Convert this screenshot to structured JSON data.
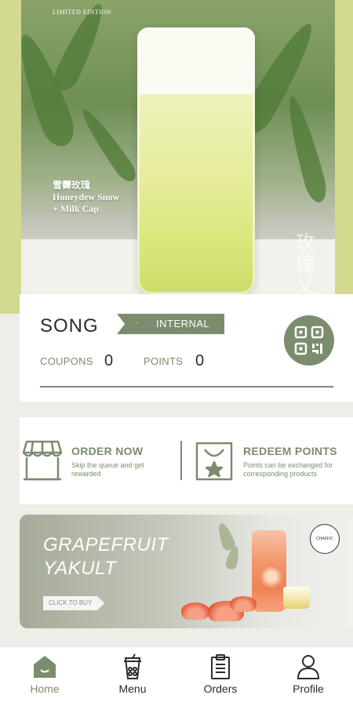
{
  "hero": {
    "tag": "LIMITED EDITION",
    "name_cn": "雪霽玫瑰",
    "name_line1": "Honeydew Snow",
    "name_line2": "+ Milk Cap",
    "watermark": "玫瑰乂"
  },
  "member": {
    "name": "SONG",
    "tier": "INTERNAL",
    "coupons_label": "COUPONS",
    "coupons_value": "0",
    "points_label": "POINTS",
    "points_value": "0"
  },
  "actions": {
    "order": {
      "title": "ORDER NOW",
      "desc": "Skip the queue and get rewarded"
    },
    "redeem": {
      "title": "REDEEM POINTS",
      "desc": "Points can be exchanged for corresponding products"
    }
  },
  "promo": {
    "title_line1": "GRAPEFRUIT",
    "title_line2": "YAKULT",
    "cta": "CLICK TO BUY",
    "logo_text": "CHAFFIC"
  },
  "nav": {
    "items": [
      {
        "label": "Home",
        "icon": "home-icon",
        "active": true
      },
      {
        "label": "Menu",
        "icon": "drink-cup-icon",
        "active": false
      },
      {
        "label": "Orders",
        "icon": "clipboard-icon",
        "active": false
      },
      {
        "label": "Profile",
        "icon": "person-icon",
        "active": false
      }
    ]
  },
  "colors": {
    "accent": "#7c8c6e",
    "lime": "#d3d98f",
    "page_bg": "#efede8"
  }
}
